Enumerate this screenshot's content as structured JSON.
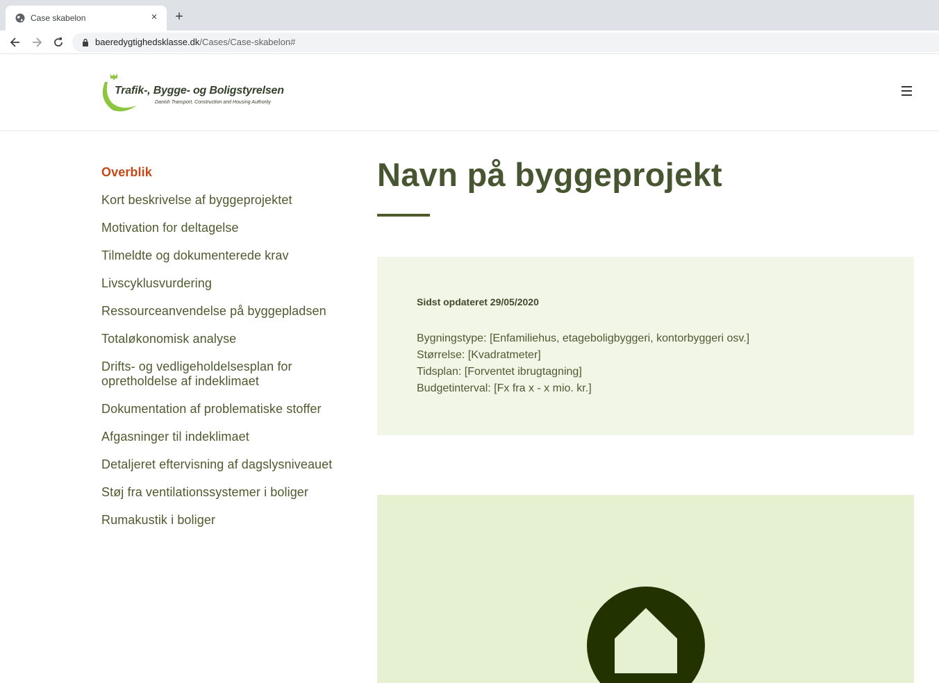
{
  "browser": {
    "tab_title": "Case skabelon",
    "tab_close": "×",
    "new_tab": "+",
    "url_domain": "baeredygtighedsklasse.dk",
    "url_path": "/Cases/Case-skabelon#"
  },
  "header": {
    "logo_title": "Trafik-, Bygge- og Boligstyrelsen",
    "logo_subtitle": "Danish Transport, Construction and Housing Authority"
  },
  "sidebar": {
    "items": [
      {
        "label": "Overblik",
        "active": true
      },
      {
        "label": "Kort beskrivelse af byggeprojektet"
      },
      {
        "label": "Motivation for deltagelse"
      },
      {
        "label": "Tilmeldte og dokumenterede krav"
      },
      {
        "label": "Livscyklusvurdering"
      },
      {
        "label": "Ressourceanvendelse på byggepladsen"
      },
      {
        "label": "Totaløkonomisk analyse"
      },
      {
        "label": "Drifts- og vedligeholdelsesplan for opretholdelse af indeklimaet"
      },
      {
        "label": "Dokumentation af problematiske stoffer"
      },
      {
        "label": "Afgasninger til indeklimaet"
      },
      {
        "label": "Detaljeret eftervisning af dagslysniveauet"
      },
      {
        "label": "Støj fra ventilationssystemer i boliger"
      },
      {
        "label": "Rumakustik i boliger"
      }
    ]
  },
  "main": {
    "title": "Navn på byggeprojekt",
    "updated": "Sidst opdateret 29/05/2020",
    "details": [
      "Bygningstype: [Enfamiliehus, etageboligbyggeri, kontorbyggeri osv.]",
      "Størrelse: [Kvadratmeter]",
      "Tidsplan: [Forventet ibrugtagning]",
      "Budgetinterval: [Fx fra x - x mio. kr.]"
    ]
  },
  "colors": {
    "accent_active": "#c44714",
    "heading": "#475630",
    "info_bg": "#f2f6e6",
    "image_bg": "#e6f1d2",
    "icon_dark": "#233300"
  }
}
